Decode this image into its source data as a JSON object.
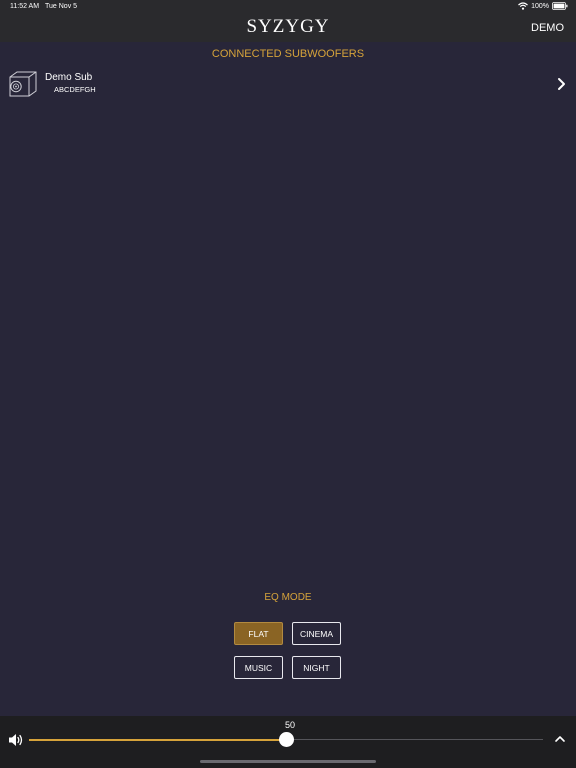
{
  "status_bar": {
    "time": "11:52 AM",
    "date": "Tue Nov 5",
    "battery": "100%",
    "icons": [
      "wifi-icon",
      "battery-icon"
    ]
  },
  "header": {
    "title": "SYZYGY",
    "demo_label": "DEMO"
  },
  "subwoofers": {
    "section_title": "CONNECTED SUBWOOFERS",
    "items": [
      {
        "name": "Demo Sub",
        "serial": "ABCDEFGH",
        "icon": "subwoofer-icon"
      }
    ]
  },
  "eq": {
    "title": "EQ MODE",
    "modes": [
      "FLAT",
      "CINEMA",
      "MUSIC",
      "NIGHT"
    ],
    "selected": "FLAT"
  },
  "volume": {
    "value": "50",
    "fraction": 0.5,
    "icon": "volume-icon"
  },
  "colors": {
    "accent": "#d6a33a",
    "background": "#282639",
    "bar": "#2a2a2d",
    "active_button": "#8a6424"
  }
}
